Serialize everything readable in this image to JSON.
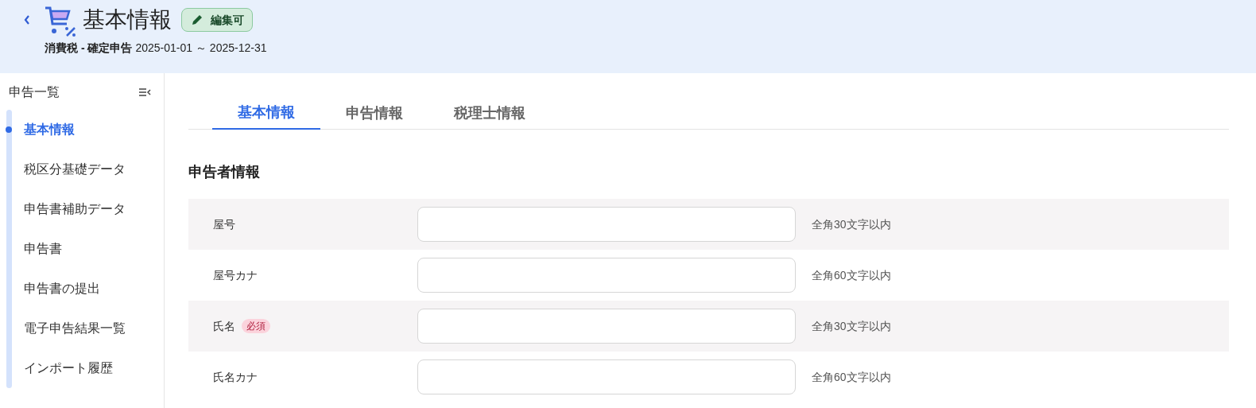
{
  "header": {
    "title": "基本情報",
    "badge": "編集可",
    "subtitle": "消費税 - 確定申告",
    "period": "2025-01-01 ～ 2025-12-31"
  },
  "sidebar": {
    "title": "申告一覧",
    "items": [
      {
        "label": "基本情報",
        "selected": true
      },
      {
        "label": "税区分基礎データ",
        "selected": false
      },
      {
        "label": "申告書補助データ",
        "selected": false
      },
      {
        "label": "申告書",
        "selected": false
      },
      {
        "label": "申告書の提出",
        "selected": false
      },
      {
        "label": "電子申告結果一覧",
        "selected": false
      },
      {
        "label": "インポート履歴",
        "selected": false
      }
    ]
  },
  "tabs": [
    {
      "label": "基本情報",
      "selected": true
    },
    {
      "label": "申告情報",
      "selected": false
    },
    {
      "label": "税理士情報",
      "selected": false
    }
  ],
  "section": {
    "title": "申告者情報",
    "rows": [
      {
        "label": "屋号",
        "hint": "全角30文字以内"
      },
      {
        "label": "屋号カナ",
        "hint": "全角60文字以内"
      },
      {
        "label": "氏名",
        "required": "必須",
        "hint": "全角30文字以内"
      },
      {
        "label": "氏名カナ",
        "hint": "全角60文字以内"
      }
    ]
  }
}
